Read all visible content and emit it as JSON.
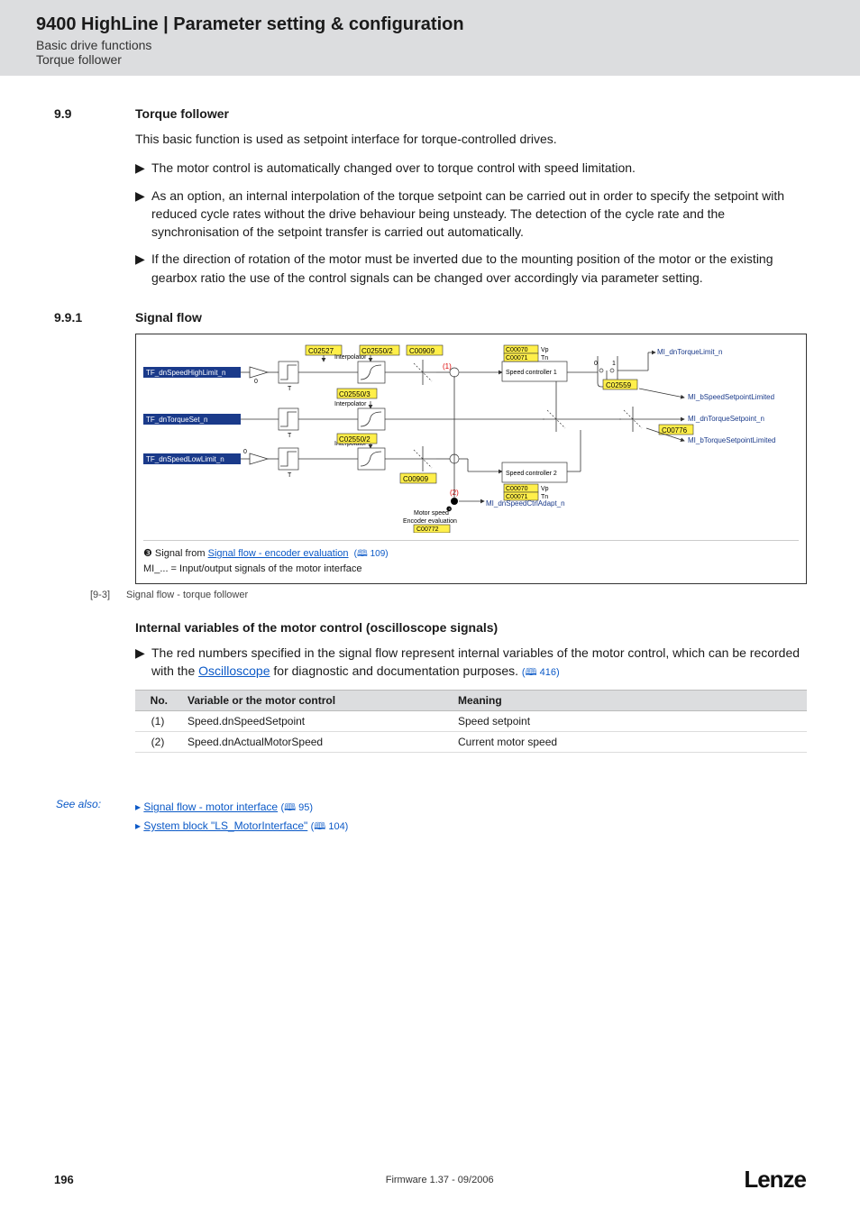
{
  "header": {
    "title": "9400 HighLine | Parameter setting & configuration",
    "sub1": "Basic drive functions",
    "sub2": "Torque follower"
  },
  "sec99": {
    "num": "9.9",
    "heading": "Torque follower"
  },
  "intro": "This basic function is used as setpoint interface for torque-controlled drives.",
  "bullets": [
    "The motor control is automatically changed over to torque control with speed limitation.",
    "As an option, an internal interpolation of the torque setpoint can be carried out in order to specify the setpoint with reduced cycle rates without the drive behaviour being unsteady. The detection of the cycle rate and the synchronisation of the setpoint transfer is carried out automatically.",
    "If the direction of rotation of the motor must be inverted due to the mounting position of the motor or the existing gearbox ratio the use of the control signals can be changed over accordingly via parameter setting."
  ],
  "sec991": {
    "num": "9.9.1",
    "heading": "Signal flow"
  },
  "diagram": {
    "codes": {
      "c02527": "C02527",
      "c02550_2": "C02550/2",
      "c02550_3": "C02550/3",
      "c02550_2b": "C02550/2",
      "c00909a": "C00909",
      "c00909b": "C00909",
      "c00070a": "C00070",
      "c00070b": "C00070",
      "c00071a": "C00071",
      "c00071b": "C00071",
      "c02559": "C02559",
      "c00776": "C00776",
      "c00772": "C00772"
    },
    "labels": {
      "interp": "Interpolator",
      "sp1": "Speed controller 1",
      "sp2": "Speed controller 2",
      "vp": "Vp",
      "tn": "Tn",
      "motorspeed": "Motor speed",
      "encoder": "Encoder evaluation"
    },
    "inputs": {
      "hi": "TF_dnSpeedHighLimit_n",
      "tq": "TF_dnTorqueSet_n",
      "lo": "TF_dnSpeedLowLimit_n"
    },
    "outputs": {
      "torqlim": "MI_dnTorqueLimit_n",
      "spdlim": "MI_bSpeedSetpointLimited",
      "torqset": "MI_dnTorqueSetpoint_n",
      "torqsetlim": "MI_bTorqueSetpointLimited",
      "spdadapt": "MI_dnSpeedCtrlAdapt_n"
    },
    "rednums": {
      "r1": "(1)",
      "r2": "(2)",
      "r3": "❸"
    },
    "legend": {
      "prefix": "❸ Signal from ",
      "link": "Signal flow - encoder evaluation",
      "page": "(🕮 109)",
      "mi": "MI_... = Input/output signals of the motor interface"
    }
  },
  "figcap": {
    "num": "[9-3]",
    "text": "Signal flow - torque follower"
  },
  "osc": {
    "heading": "Internal variables of the motor control (oscilloscope signals)",
    "bullet_a": "The red numbers specified in the signal flow represent internal variables of the motor control, which can be recorded with the ",
    "bullet_link": "Oscilloscope",
    "bullet_b": " for diagnostic and documentation purposes.",
    "bullet_pg": "(🕮 416)"
  },
  "table": {
    "h_no": "No.",
    "h_var": "Variable or the motor control",
    "h_mean": "Meaning",
    "rows": [
      {
        "no": "(1)",
        "var": "Speed.dnSpeedSetpoint",
        "mean": "Speed setpoint"
      },
      {
        "no": "(2)",
        "var": "Speed.dnActualMotorSpeed",
        "mean": "Current motor speed"
      }
    ]
  },
  "seealso": {
    "label": "See also:",
    "items": [
      {
        "text": "Signal flow - motor interface",
        "pg": "(🕮 95)"
      },
      {
        "text": "System block \"LS_MotorInterface\"",
        "pg": "(🕮 104)"
      }
    ]
  },
  "footer": {
    "page": "196",
    "fw": "Firmware 1.37 - 09/2006",
    "logo": "Lenze"
  }
}
